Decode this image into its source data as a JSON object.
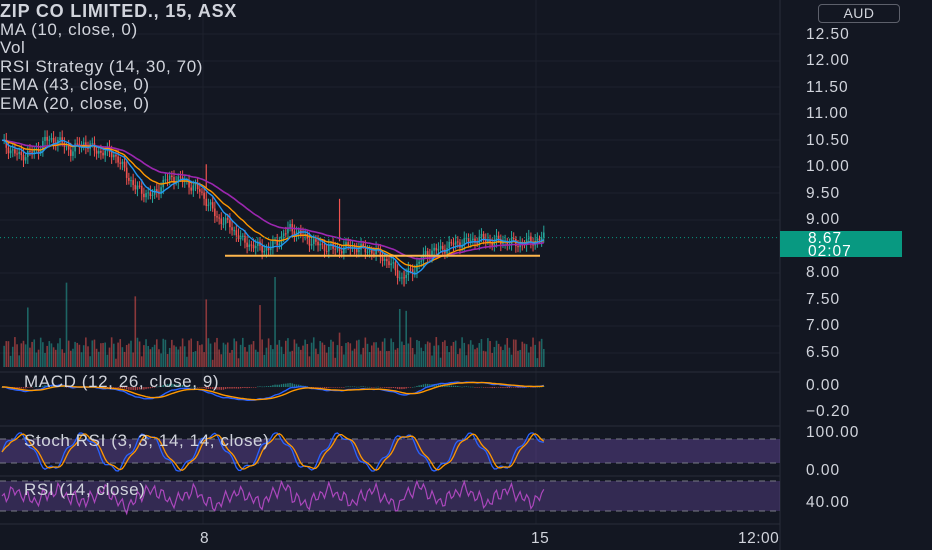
{
  "header": {
    "symbol_line": "ZIP CO LIMITED., 15, ASX",
    "indicators": [
      "MA (10, close, 0)",
      "Vol",
      "RSI Strategy (14, 30, 70)",
      "EMA (43, close, 0)",
      "EMA (20, close, 0)"
    ]
  },
  "currency": "AUD",
  "last_price": {
    "value": "8.67",
    "countdown": "02:07"
  },
  "panes": {
    "macd_label": "MACD (12, 26, close, 9)",
    "stoch_label": "Stoch RSI (3, 3, 14, 14, close)",
    "rsi_label": "RSI (14, close)"
  },
  "price_axis": [
    "12.50",
    "12.00",
    "11.50",
    "11.00",
    "10.50",
    "10.00",
    "9.50",
    "9.00",
    "8.00",
    "7.50",
    "7.00",
    "6.50"
  ],
  "macd_axis": [
    "0.00",
    "−0.20"
  ],
  "stoch_axis": [
    "100.00",
    "0.00"
  ],
  "rsi_axis": [
    "40.00"
  ],
  "time_axis": [
    "8",
    "15",
    "12:00"
  ],
  "colors": {
    "background": "#131722",
    "up": "#26a69a",
    "down": "#ef5350",
    "ma10": "#2196f3",
    "ema43": "#9c27b0",
    "ema20": "#ff9800",
    "support_line": "#ffeb3b",
    "rsi": "#ab47bc"
  },
  "chart_data": {
    "type": "line",
    "title": "ZIP CO LIMITED., 15, ASX",
    "x_time_labels": [
      "8",
      "15"
    ],
    "y_range": [
      6.3,
      12.6
    ],
    "close_path_x_index": [
      0,
      8,
      16,
      20,
      26,
      32,
      38,
      44,
      52,
      56,
      62,
      70,
      76,
      80,
      86,
      92,
      96,
      100,
      106,
      112,
      118,
      124,
      128,
      134,
      140,
      146,
      150,
      156,
      162,
      168,
      174,
      180,
      186,
      192,
      198,
      204,
      210,
      216,
      222,
      228,
      234,
      240,
      246,
      252
    ],
    "close_values": [
      10.45,
      10.2,
      10.3,
      10.5,
      10.5,
      10.3,
      10.45,
      10.3,
      10.25,
      10.0,
      9.6,
      9.45,
      9.75,
      9.8,
      9.7,
      9.55,
      9.3,
      9.05,
      8.9,
      8.6,
      8.5,
      8.45,
      8.6,
      8.85,
      8.7,
      8.55,
      8.5,
      8.45,
      8.5,
      8.45,
      8.4,
      8.2,
      7.9,
      8.1,
      8.4,
      8.45,
      8.55,
      8.6,
      8.65,
      8.6,
      8.6,
      8.55,
      8.6,
      8.67
    ],
    "support_level": 8.33,
    "last_close": 8.67
  }
}
